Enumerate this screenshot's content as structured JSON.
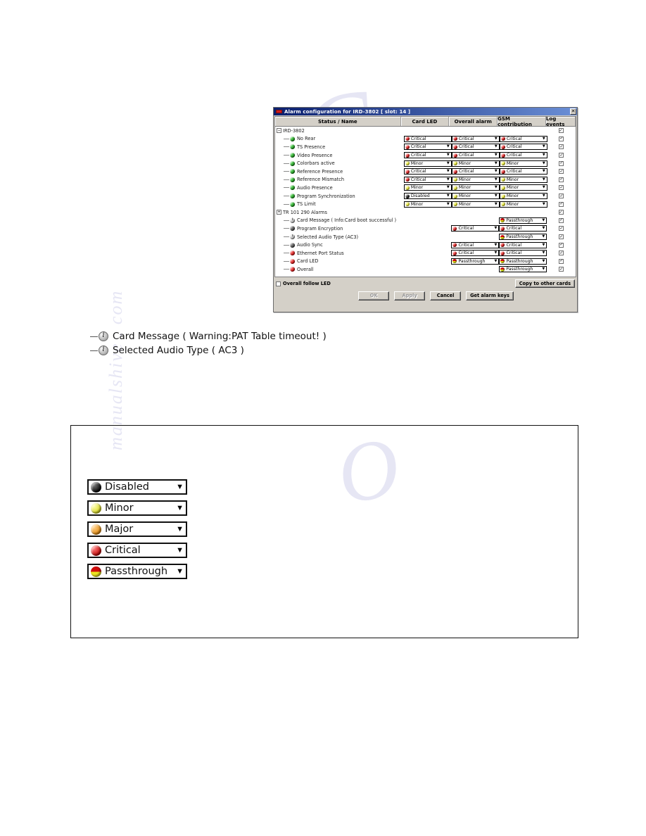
{
  "dialog": {
    "title": "Alarm configuration for IRD-3802 [ slot: 14 ]",
    "title_icon": "app-icon",
    "close_label": "✕",
    "columns": [
      {
        "label": "Status / Name",
        "key": "name"
      },
      {
        "label": "Card LED",
        "key": "card_led"
      },
      {
        "label": "Overall alarm",
        "key": "overall_alarm"
      },
      {
        "label": "GSM contribution",
        "key": "gsm_contribution"
      },
      {
        "label": "Log events",
        "key": "log_events"
      }
    ],
    "rows": [
      {
        "label": "IRD-3802",
        "level": 0,
        "expander": "−",
        "status": null,
        "card_led": null,
        "overall_alarm": null,
        "gsm_contribution": null,
        "log_events": true
      },
      {
        "label": "No Rear",
        "level": 1,
        "status": "green",
        "card_led": {
          "value": "Critical",
          "dot": "red",
          "arrow": false
        },
        "overall_alarm": {
          "value": "Critical",
          "dot": "red",
          "arrow": true
        },
        "gsm_contribution": {
          "value": "Critical",
          "dot": "red",
          "arrow": true
        },
        "log_events": true
      },
      {
        "label": "TS Presence",
        "level": 1,
        "status": "green",
        "card_led": {
          "value": "Critical",
          "dot": "red",
          "arrow": true
        },
        "overall_alarm": {
          "value": "Critical",
          "dot": "red",
          "arrow": true
        },
        "gsm_contribution": {
          "value": "Critical",
          "dot": "red",
          "arrow": true
        },
        "log_events": true
      },
      {
        "label": "Video Presence",
        "level": 1,
        "status": "green",
        "card_led": {
          "value": "Critical",
          "dot": "red",
          "arrow": true
        },
        "overall_alarm": {
          "value": "Critical",
          "dot": "red",
          "arrow": true
        },
        "gsm_contribution": {
          "value": "Critical",
          "dot": "red",
          "arrow": true
        },
        "log_events": true
      },
      {
        "label": "Colorbars active",
        "level": 1,
        "status": "green",
        "card_led": {
          "value": "Minor",
          "dot": "yellow",
          "arrow": true
        },
        "overall_alarm": {
          "value": "Minor",
          "dot": "yellow",
          "arrow": true
        },
        "gsm_contribution": {
          "value": "Minor",
          "dot": "yellow",
          "arrow": true
        },
        "log_events": true
      },
      {
        "label": "Reference Presence",
        "level": 1,
        "status": "green",
        "card_led": {
          "value": "Critical",
          "dot": "red",
          "arrow": true
        },
        "overall_alarm": {
          "value": "Critical",
          "dot": "red",
          "arrow": true
        },
        "gsm_contribution": {
          "value": "Critical",
          "dot": "red",
          "arrow": true
        },
        "log_events": true
      },
      {
        "label": "Reference Mismatch",
        "level": 1,
        "status": "green",
        "card_led": {
          "value": "Critical",
          "dot": "red",
          "arrow": true
        },
        "overall_alarm": {
          "value": "Minor",
          "dot": "yellow",
          "arrow": true
        },
        "gsm_contribution": {
          "value": "Minor",
          "dot": "yellow",
          "arrow": true
        },
        "log_events": true
      },
      {
        "label": "Audio Presence",
        "level": 1,
        "status": "green",
        "card_led": {
          "value": "Minor",
          "dot": "yellow",
          "arrow": true
        },
        "overall_alarm": {
          "value": "Minor",
          "dot": "yellow",
          "arrow": true
        },
        "gsm_contribution": {
          "value": "Minor",
          "dot": "yellow",
          "arrow": true
        },
        "log_events": true
      },
      {
        "label": "Program Synchronization",
        "level": 1,
        "status": "green",
        "card_led": {
          "value": "Disabled",
          "dot": "black",
          "arrow": true
        },
        "overall_alarm": {
          "value": "Minor",
          "dot": "yellow",
          "arrow": true
        },
        "gsm_contribution": {
          "value": "Minor",
          "dot": "yellow",
          "arrow": true
        },
        "log_events": true
      },
      {
        "label": "TS Limit",
        "level": 1,
        "status": "green",
        "card_led": {
          "value": "Minor",
          "dot": "yellow",
          "arrow": true
        },
        "overall_alarm": {
          "value": "Minor",
          "dot": "yellow",
          "arrow": true
        },
        "gsm_contribution": {
          "value": "Minor",
          "dot": "yellow",
          "arrow": true
        },
        "log_events": true
      },
      {
        "label": "TR 101 290 Alarms",
        "level": 0,
        "expander": "+",
        "status": null,
        "card_led": null,
        "overall_alarm": null,
        "gsm_contribution": null,
        "log_events": true
      },
      {
        "label": "Card Message ( Info:Card boot successful )",
        "level": 1,
        "status": "info",
        "card_led": null,
        "overall_alarm": null,
        "gsm_contribution": {
          "value": "Passthrough",
          "dot": "passthrough",
          "arrow": true
        },
        "log_events": true
      },
      {
        "label": "Program Encryption",
        "level": 1,
        "status": "gray",
        "card_led": null,
        "overall_alarm": {
          "value": "Critical",
          "dot": "red",
          "arrow": true
        },
        "gsm_contribution": {
          "value": "Critical",
          "dot": "red",
          "arrow": true
        },
        "log_events": true
      },
      {
        "label": "Selected Audio Type (AC3)",
        "level": 1,
        "status": "info",
        "card_led": null,
        "overall_alarm": null,
        "gsm_contribution": {
          "value": "Passthrough",
          "dot": "passthrough",
          "arrow": true
        },
        "log_events": true
      },
      {
        "label": "Audio Sync",
        "level": 1,
        "status": "gray",
        "card_led": null,
        "overall_alarm": {
          "value": "Critical",
          "dot": "red",
          "arrow": true
        },
        "gsm_contribution": {
          "value": "Critical",
          "dot": "red",
          "arrow": true
        },
        "log_events": true
      },
      {
        "label": "Ethernet Port Status",
        "level": 1,
        "status": "red",
        "card_led": null,
        "overall_alarm": {
          "value": "Critical",
          "dot": "red",
          "arrow": true
        },
        "gsm_contribution": {
          "value": "Critical",
          "dot": "red",
          "arrow": true
        },
        "log_events": true
      },
      {
        "label": "Card LED",
        "level": 1,
        "status": "red",
        "card_led": null,
        "overall_alarm": {
          "value": "Passthrough",
          "dot": "passthrough",
          "arrow": true
        },
        "gsm_contribution": {
          "value": "Passthrough",
          "dot": "passthrough",
          "arrow": true
        },
        "log_events": true
      },
      {
        "label": "Overall",
        "level": 1,
        "status": "red",
        "card_led": null,
        "overall_alarm": null,
        "gsm_contribution": {
          "value": "Passthrough",
          "dot": "passthrough",
          "arrow": true
        },
        "log_events": true
      }
    ],
    "footer": {
      "overall_follow_led_label": "Overall follow LED",
      "overall_follow_led_checked": false,
      "copy_to_other_cards": "Copy to other cards",
      "ok": "OK",
      "ok_enabled": false,
      "apply": "Apply",
      "apply_enabled": false,
      "cancel": "Cancel",
      "get_alarm_keys": "Get alarm keys"
    }
  },
  "callouts": [
    {
      "icon": "info-icon",
      "text": "Card Message ( Warning:PAT Table timeout! )"
    },
    {
      "icon": "info-icon",
      "text": "Selected Audio Type ( AC3 )"
    }
  ],
  "legend": {
    "items": [
      {
        "label": "Disabled",
        "dot": "black",
        "arrow": "▼"
      },
      {
        "label": "Minor",
        "dot": "yellow",
        "arrow": "▼"
      },
      {
        "label": "Major",
        "dot": "orange",
        "arrow": "▼"
      },
      {
        "label": "Critical",
        "dot": "red",
        "arrow": "▼"
      },
      {
        "label": "Passthrough",
        "dot": "passthrough",
        "arrow": "▼"
      }
    ]
  },
  "watermark": {
    "l1": "C",
    "l2": "manualshive . com",
    "l3": "O"
  },
  "colors": {
    "title_bar_dark": "#0a1f6e",
    "title_bar_light": "#6b8fd6",
    "dialog_face": "#d4d0c8",
    "critical": "#c00606",
    "minor": "#d8d81a",
    "major": "#e08a12",
    "disabled": "#0a0a0a",
    "ok_green": "#138513"
  }
}
